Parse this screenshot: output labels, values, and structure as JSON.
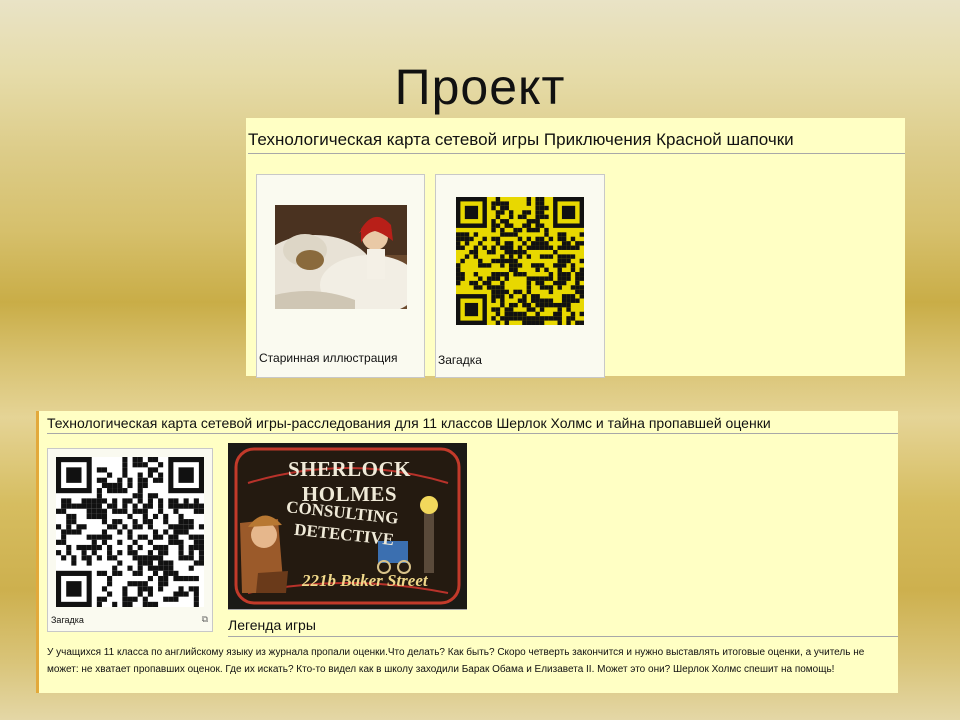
{
  "slide": {
    "title": "Проект"
  },
  "project1": {
    "heading": "Технологическая карта сетевой игры Приключения Красной шапочки",
    "items": [
      {
        "caption": "Старинная иллюстрация",
        "image": "old-illustration-red-riding-hood"
      },
      {
        "caption": "Загадка",
        "image": "qr-code-yellow"
      }
    ]
  },
  "project2": {
    "heading": "Технологическая карта сетевой игры-расследования для 11 классов Шерлок Холмс и тайна пропавшей оценки",
    "qr_caption": "Загадка",
    "sign": {
      "line1": "SHERLOCK HOLMES",
      "line2": "CONSULTING",
      "line3": "DETECTIVE",
      "line4": "221b Baker Street"
    },
    "legend_title": "Легенда игры",
    "legend_text": "У учащихся 11 класса по английскому языку из журнала пропали оценки.Что делать? Как быть? Скоро четверть закончится и нужно выставлять итоговые оценки, а учитель не может: не хватает пропавших оценок. Где их искать? Кто-то видел как в школу заходили Барак Обама и Елизавета II. Может это они? Шерлок Холмс спешит на помощь!"
  },
  "colors": {
    "panel": "#ffffc4",
    "accent_border": "#e3a93a",
    "qr_yellow": "#e8d800"
  }
}
